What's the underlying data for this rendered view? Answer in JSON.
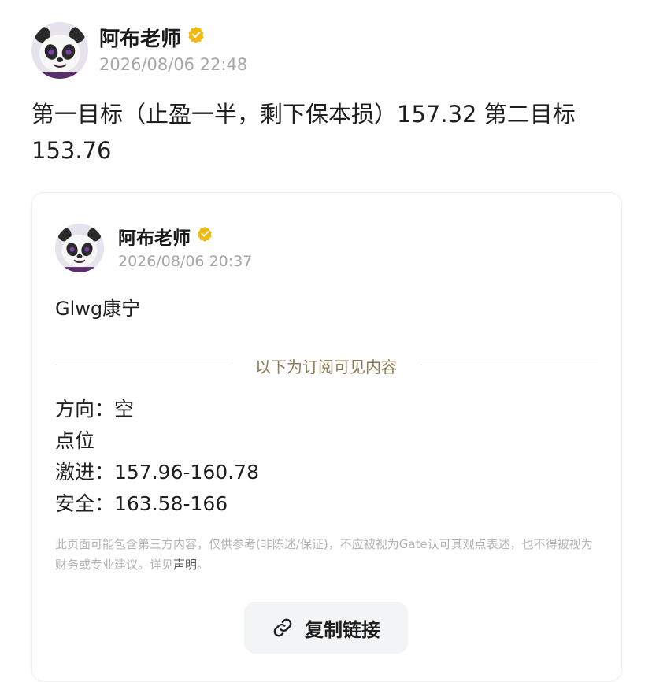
{
  "post": {
    "author": "阿布老师",
    "verified_icon": "verified-badge-icon",
    "timestamp": "2026/08/06 22:48",
    "text_line1": "第一目标（止盈一半，剩下保本损）157.32 第二目标",
    "text_line2": "153.76"
  },
  "quoted": {
    "author": "阿布老师",
    "timestamp": "2026/08/06 20:37",
    "message": "Glwg康宁",
    "divider_label": "以下为订阅可见内容",
    "lines": [
      "方向：空",
      "点位",
      "激进：157.96-160.78",
      "安全：163.58-166"
    ],
    "disclaimer_text": "此页面可能包含第三方内容，仅供参考(非陈述/保证)，不应被视为Gate认可其观点表述，也不得被视为财务或专业建议。详见",
    "disclaimer_link": "声明",
    "disclaimer_end": "。"
  },
  "copy_button": {
    "label": "复制链接",
    "icon": "link-icon"
  },
  "colors": {
    "verified": "#f0b90b",
    "divider_label": "#8a7a55",
    "timestamp": "#a6a6a6"
  }
}
